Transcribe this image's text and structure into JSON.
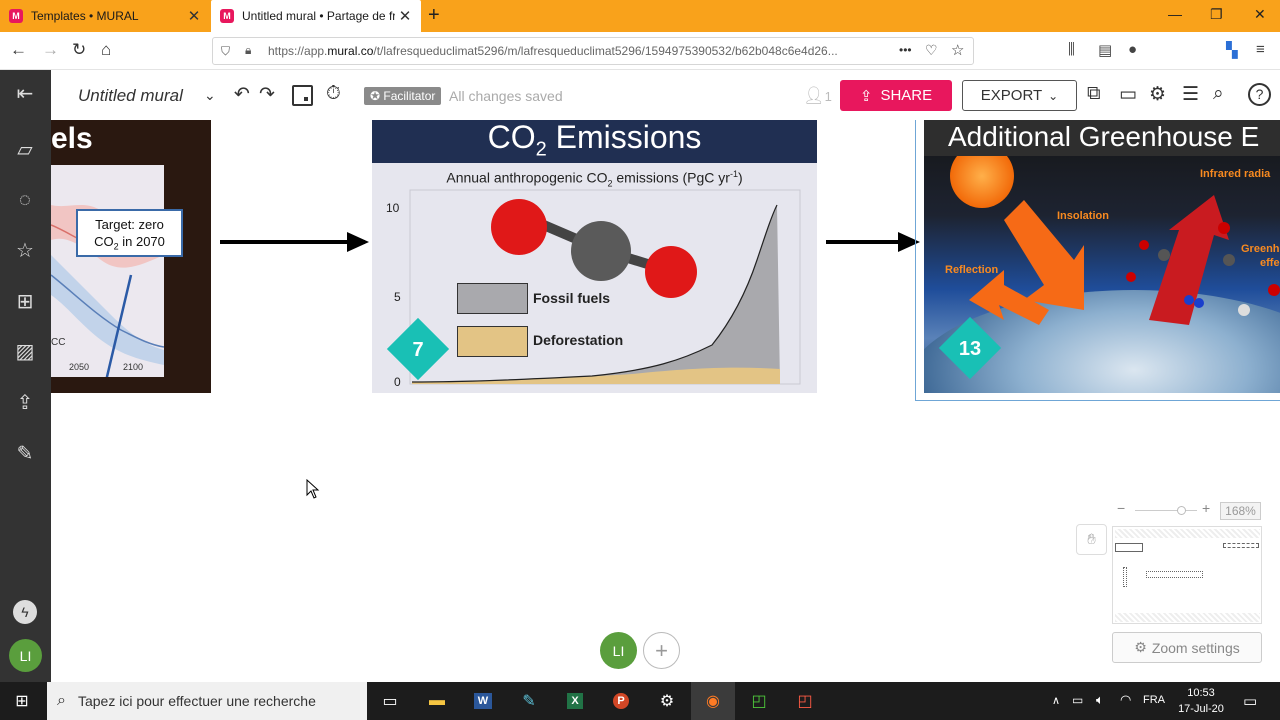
{
  "browser": {
    "tabs": [
      {
        "title": "Templates • MURAL",
        "close": "✕"
      },
      {
        "title": "Untitled mural • Partage de fres",
        "close": "✕"
      }
    ],
    "newtab": "+",
    "url_prefix": "https://app.",
    "url_domain": "mural.co",
    "url_path": "/t/lafresqueduclimat5296/m/lafresqueduclimat5296/1594975390532/b62b048c6e4d26...",
    "url_more": "•••"
  },
  "toolbar": {
    "mural_title": "Untitled mural",
    "facilitator_label": "Facilitator",
    "saved_status": "All changes saved",
    "user_count": "1",
    "share_label": "SHARE",
    "export_label": "EXPORT"
  },
  "canvas": {
    "slide_left": {
      "title_fragment": "els",
      "target_line1": "Target: zero",
      "target_line2_prefix": "CO",
      "target_line2_sub": "2",
      "target_line2_suffix": " in 2070",
      "tick_2050": "2050",
      "tick_2100": "2100",
      "cc_label": "CC"
    },
    "slide_co2": {
      "title_prefix": "CO",
      "title_sub": "2",
      "title_suffix": " Emissions",
      "subtitle_prefix": "Annual anthropogenic CO",
      "subtitle_sub": "2",
      "subtitle_mid": " emissions  (PgC yr",
      "subtitle_sup": "-1",
      "subtitle_suffix": ")",
      "y_ticks": [
        "10",
        "5",
        "0"
      ],
      "legend": [
        {
          "label": "Fossil fuels",
          "color": "#a9a9ad"
        },
        {
          "label": "Deforestation",
          "color": "#e3c485"
        }
      ],
      "badge": "7"
    },
    "slide_greenhouse": {
      "title": "Additional Greenhouse E",
      "labels": {
        "infrared": "Infrared radia",
        "insolation": "Insolation",
        "reflection": "Reflection",
        "greenhouse": "Greenh",
        "effect": "effe"
      },
      "badge": "13"
    }
  },
  "zoom": {
    "minus": "−",
    "plus": "+",
    "percent": "168%",
    "settings_label": "Zoom settings"
  },
  "collaborators": {
    "initials": "LI",
    "add": "+"
  },
  "taskbar": {
    "search_placeholder": "Tapez ici pour effectuer une recherche",
    "lang": "FRA",
    "time": "10:53",
    "date": "17-Jul-20"
  },
  "colors": {
    "tabbar": "#f9a21b",
    "accent": "#e8175d",
    "rail": "#333333",
    "badge": "#19c0b5"
  }
}
